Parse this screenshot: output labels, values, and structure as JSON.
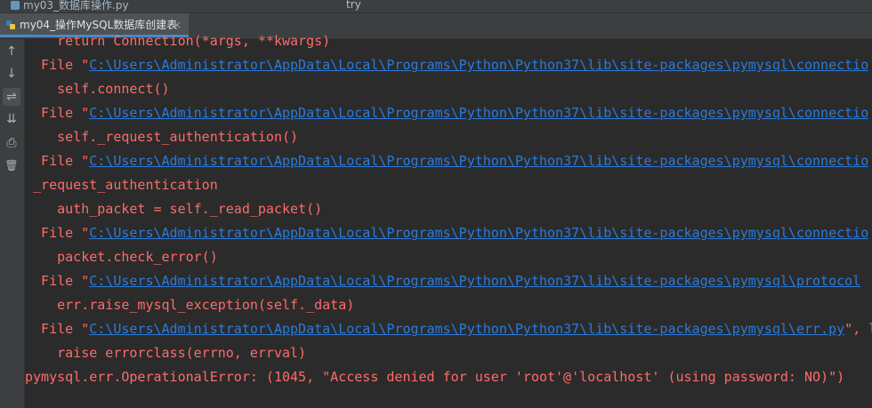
{
  "window": {
    "prev_tab_label": "my03_数据库操作.py",
    "run_label": "try"
  },
  "tab": {
    "label": "my04_操作MySQL数据库创建表",
    "close": "×"
  },
  "gutter": {
    "buttons": [
      {
        "icon": "arrow-up-icon",
        "glyph": "↑"
      },
      {
        "icon": "arrow-down-icon",
        "glyph": "↓"
      },
      {
        "icon": "soft-wrap-icon",
        "glyph": "⇌"
      },
      {
        "icon": "scroll-to-end-icon",
        "glyph": "⇊"
      },
      {
        "icon": "print-icon",
        "glyph": "⎙"
      },
      {
        "icon": "trash-icon",
        "glyph": "🗑"
      }
    ]
  },
  "console": {
    "lines": [
      {
        "pre": "    return Connection(*args, **kwargs)",
        "link": "",
        "post": ""
      },
      {
        "pre": "  File \"",
        "link": "C:\\Users\\Administrator\\AppData\\Local\\Programs\\Python\\Python37\\lib\\site-packages\\pymysql\\connectio",
        "post": ""
      },
      {
        "pre": "    self.connect()",
        "link": "",
        "post": ""
      },
      {
        "pre": "  File \"",
        "link": "C:\\Users\\Administrator\\AppData\\Local\\Programs\\Python\\Python37\\lib\\site-packages\\pymysql\\connectio",
        "post": ""
      },
      {
        "pre": "    self._request_authentication()",
        "link": "",
        "post": ""
      },
      {
        "pre": "  File \"",
        "link": "C:\\Users\\Administrator\\AppData\\Local\\Programs\\Python\\Python37\\lib\\site-packages\\pymysql\\connectio",
        "post": ""
      },
      {
        "pre": " _request_authentication",
        "link": "",
        "post": ""
      },
      {
        "pre": "    auth_packet = self._read_packet()",
        "link": "",
        "post": ""
      },
      {
        "pre": "  File \"",
        "link": "C:\\Users\\Administrator\\AppData\\Local\\Programs\\Python\\Python37\\lib\\site-packages\\pymysql\\connectio",
        "post": ""
      },
      {
        "pre": "    packet.check_error()",
        "link": "",
        "post": ""
      },
      {
        "pre": "  File \"",
        "link": "C:\\Users\\Administrator\\AppData\\Local\\Programs\\Python\\Python37\\lib\\site-packages\\pymysql\\protocol",
        "post": ""
      },
      {
        "pre": "    err.raise_mysql_exception(self._data)",
        "link": "",
        "post": ""
      },
      {
        "pre": "  File \"",
        "link": "C:\\Users\\Administrator\\AppData\\Local\\Programs\\Python\\Python37\\lib\\site-packages\\pymysql\\err.py",
        "post": "\", l"
      },
      {
        "pre": "    raise errorclass(errno, errval)",
        "link": "",
        "post": ""
      },
      {
        "pre": "pymysql.err.OperationalError: (1045, \"Access denied for user 'root'@'localhost' (using password: NO)\")",
        "link": "",
        "post": ""
      }
    ]
  },
  "colors": {
    "error_text": "#ff6b68",
    "link": "#287bde",
    "background": "#2b2b2b"
  }
}
